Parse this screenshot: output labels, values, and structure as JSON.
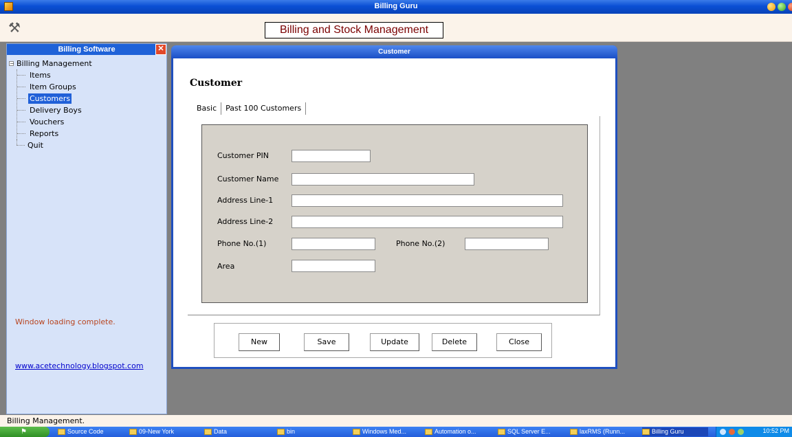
{
  "window": {
    "title": "Billing Guru"
  },
  "toolbar": {
    "banner": "Billing and Stock Management",
    "tools_icon": "tools-icon"
  },
  "sidebar": {
    "title": "Billing Software",
    "close_glyph": "✕",
    "root_label": "Billing Management",
    "expander": "−",
    "items": [
      {
        "label": "Items"
      },
      {
        "label": "Item Groups"
      },
      {
        "label": "Customers",
        "selected": true
      },
      {
        "label": "Delivery Boys"
      },
      {
        "label": "Vouchers"
      },
      {
        "label": "Reports"
      }
    ],
    "quit_label": "Quit",
    "status_note": "Window loading complete.",
    "link": "www.acetechnology.blogspot.com"
  },
  "customer_window": {
    "title": "Customer",
    "heading": "Customer",
    "tabs": [
      {
        "label": "Basic"
      },
      {
        "label": "Past 100 Customers"
      }
    ],
    "fields": {
      "pin": {
        "label": "Customer PIN",
        "value": ""
      },
      "name": {
        "label": "Customer Name",
        "value": ""
      },
      "addr1": {
        "label": "Address Line-1",
        "value": ""
      },
      "addr2": {
        "label": "Address Line-2",
        "value": ""
      },
      "phone1": {
        "label": "Phone No.(1)",
        "value": ""
      },
      "phone2": {
        "label": "Phone No.(2)",
        "value": ""
      },
      "area": {
        "label": "Area",
        "value": ""
      }
    },
    "buttons": {
      "new": "New",
      "save": "Save",
      "update": "Update",
      "delete": "Delete",
      "close": "Close"
    }
  },
  "statusbar": {
    "text": "Billing Management."
  },
  "taskbar": {
    "items": [
      {
        "label": "Source Code"
      },
      {
        "label": "09-New York"
      },
      {
        "label": "Data"
      },
      {
        "label": "bin"
      },
      {
        "label": "Windows Med..."
      },
      {
        "label": "Automation o..."
      },
      {
        "label": "SQL Server E..."
      },
      {
        "label": "laxRMS (Runn..."
      },
      {
        "label": "Billing Guru",
        "active": true
      }
    ],
    "clock": "10:52 PM"
  }
}
